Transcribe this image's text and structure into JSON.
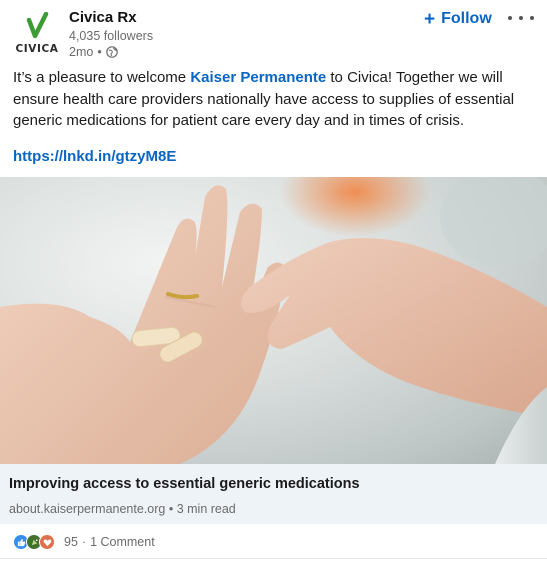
{
  "header": {
    "logo_text": "CIVICA",
    "company_name": "Civica Rx",
    "followers": "4,035 followers",
    "time": "2mo",
    "follow_label": "Follow"
  },
  "post": {
    "text_before": "It’s a pleasure to welcome ",
    "mention": "Kaiser Permanente",
    "text_after": " to Civica! Together we will ensure health care providers nationally have access to supplies of essential generic medications for patient care every day and in times of crisis.",
    "link": "https://lnkd.in/gtzyM8E"
  },
  "card": {
    "title": "Improving access to essential generic medications",
    "domain": "about.kaiserpermanente.org",
    "read_time": "3 min read"
  },
  "social": {
    "reaction_icons": [
      "like-icon",
      "celebrate-icon",
      "love-icon"
    ],
    "reaction_count": "95",
    "comments": "1 Comment"
  },
  "colors": {
    "accent": "#0a66c2",
    "logo_green": "#3d9b35",
    "card_bg": "#eef3f8"
  }
}
